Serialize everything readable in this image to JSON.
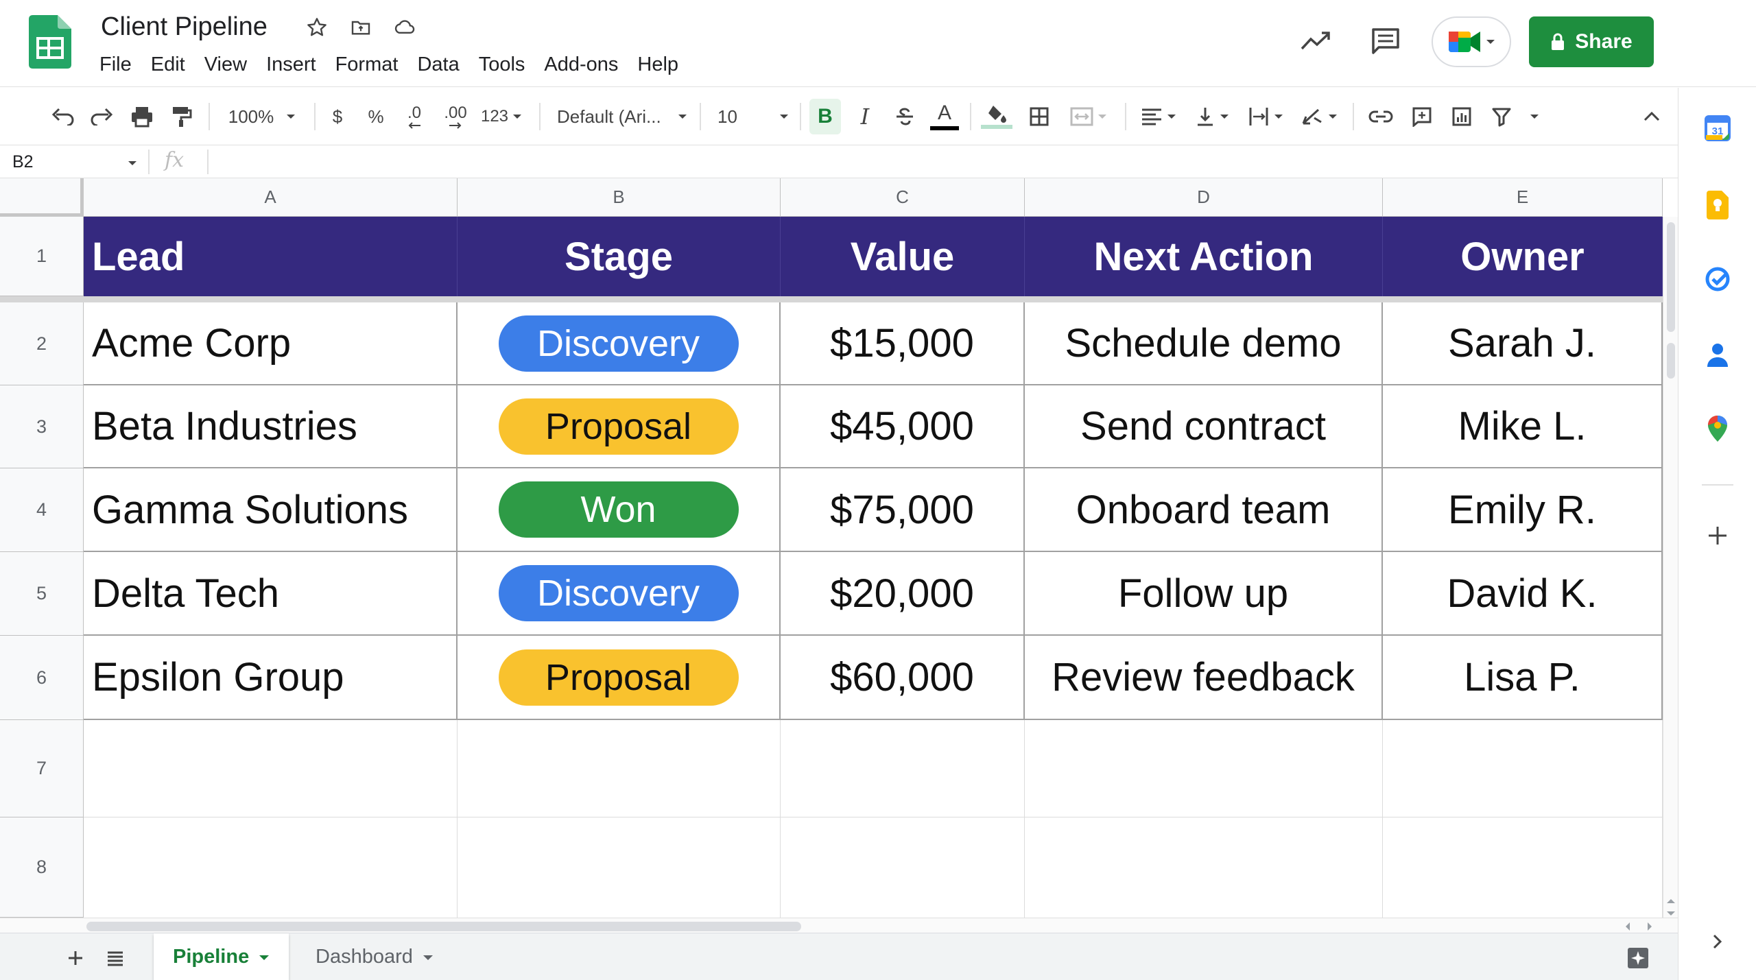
{
  "app": {
    "doc_title": "Client Pipeline",
    "menu": [
      "File",
      "Edit",
      "View",
      "Insert",
      "Format",
      "Data",
      "Tools",
      "Add-ons",
      "Help"
    ],
    "share_label": "Share",
    "brand_green": "#1e8e3e",
    "title_icons": [
      "star-icon",
      "move-to-folder-icon",
      "cloud-status-icon"
    ],
    "header_icons": [
      "activity-trend-icon",
      "comments-icon",
      "google-meet-icon"
    ]
  },
  "toolbar": {
    "zoom": "100%",
    "currency": "$",
    "percent": "%",
    "decrease_decimals": ".0",
    "increase_decimals": ".00",
    "more_formats": "123",
    "font": "Default (Ari...",
    "font_size": "10",
    "bold": "B",
    "italic": "I",
    "text_color": "A"
  },
  "formula_bar": {
    "cell_ref": "B2",
    "fx": "fx",
    "value": ""
  },
  "grid": {
    "columns": [
      "A",
      "B",
      "C",
      "D",
      "E"
    ],
    "row_numbers": [
      "1",
      "2",
      "3",
      "4",
      "5",
      "6",
      "7",
      "8"
    ],
    "header_row": [
      "Lead",
      "Stage",
      "Value",
      "Next Action",
      "Owner"
    ],
    "header_color": "#35297f",
    "rows": [
      {
        "lead": "Acme Corp",
        "stage": "Discovery",
        "stage_style": "discovery",
        "value": "$15,000",
        "next_action": "Schedule demo",
        "owner": "Sarah J."
      },
      {
        "lead": "Beta Industries",
        "stage": "Proposal",
        "stage_style": "proposal",
        "value": "$45,000",
        "next_action": "Send contract",
        "owner": "Mike L."
      },
      {
        "lead": "Gamma Solutions",
        "stage": "Won",
        "stage_style": "won",
        "value": "$75,000",
        "next_action": "Onboard team",
        "owner": "Emily R."
      },
      {
        "lead": "Delta Tech",
        "stage": "Discovery",
        "stage_style": "discovery",
        "value": "$20,000",
        "next_action": "Follow up",
        "owner": "David K."
      },
      {
        "lead": "Epsilon Group",
        "stage": "Proposal",
        "stage_style": "proposal",
        "value": "$60,000",
        "next_action": "Review feedback",
        "owner": "Lisa P."
      }
    ],
    "stage_colors": {
      "discovery": "#3c7ee8",
      "proposal": "#f9c22e",
      "won": "#2e9b46"
    }
  },
  "sheets": {
    "tabs": [
      {
        "label": "Pipeline",
        "active": true
      },
      {
        "label": "Dashboard",
        "active": false
      }
    ]
  },
  "side_panel": {
    "icons": [
      "calendar-icon",
      "keep-icon",
      "tasks-icon",
      "contacts-icon",
      "maps-icon",
      "add-addon-icon"
    ]
  }
}
